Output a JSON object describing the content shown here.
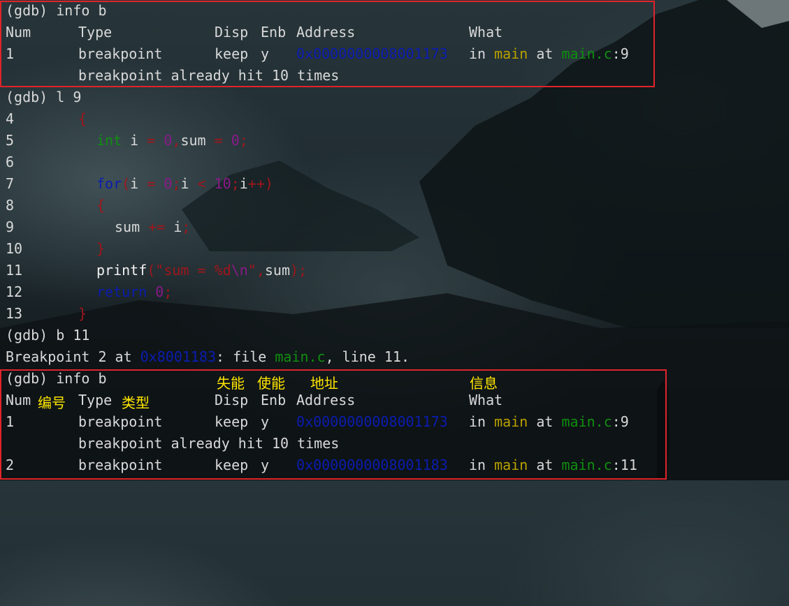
{
  "section1": {
    "prompt": "(gdb) info b",
    "header": {
      "num": "Num",
      "type": "Type",
      "disp": "Disp",
      "enb": "Enb",
      "address": "Address",
      "what": "What"
    },
    "row1": {
      "num": "1",
      "type": "breakpoint",
      "disp": "keep",
      "enb": "y",
      "address": "0x0000000008001173",
      "in": "in",
      "func": "main",
      "at": "at",
      "file": "main.c",
      "sep": ":",
      "line": "9"
    },
    "hit": "breakpoint already hit 10 times"
  },
  "list_cmd": "(gdb) l 9",
  "source": [
    {
      "n": "4"
    },
    {
      "n": "5",
      "kw": "int",
      "v1": " i ",
      "op1": "=",
      "sp1": " ",
      "num1": "0",
      "comma": ",",
      "v2": "sum ",
      "op2": "=",
      "sp2": " ",
      "num2": "0",
      "semi": ";"
    },
    {
      "n": "6"
    },
    {
      "n": "7",
      "kw": "for",
      "lp": "(",
      "v1": "i ",
      "op1": "=",
      "sp1": " ",
      "num1": "0",
      "semi1": ";",
      "v2": "i ",
      "op2": "<",
      "sp2": " ",
      "num2": "10",
      "semi2": ";",
      "v3": "i",
      "op3": "++",
      "rp": ")"
    },
    {
      "n": "8"
    },
    {
      "n": "9",
      "v1": "sum ",
      "op1": "+=",
      "v2": " i",
      "semi": ";"
    },
    {
      "n": "10"
    },
    {
      "n": "11",
      "fn": "printf",
      "lp": "(",
      "q1": "\"",
      "str": "sum = ",
      "fmt": "%d",
      "esc": "\\n",
      "q2": "\"",
      "comma": ",",
      "arg": "sum",
      "rp": ")",
      "semi": ";"
    },
    {
      "n": "12",
      "kw": "return",
      "sp": " ",
      "num": "0",
      "semi": ";"
    },
    {
      "n": "13"
    }
  ],
  "brace_open": "{",
  "brace_close": "}",
  "b_cmd": "(gdb) b 11",
  "bp_msg": {
    "pre": "Breakpoint 2 at ",
    "addr": "0x8001183",
    "mid": ": file ",
    "file": "main.c",
    "post": ", line 11."
  },
  "section2": {
    "prompt": "(gdb) info b",
    "header": {
      "num": "Num",
      "type": "Type",
      "disp": "Disp",
      "enb": "Enb",
      "address": "Address",
      "what": "What"
    },
    "row1": {
      "num": "1",
      "type": "breakpoint",
      "disp": "keep",
      "enb": "y",
      "address": "0x0000000008001173",
      "in": "in",
      "func": "main",
      "at": "at",
      "file": "main.c",
      "sep": ":",
      "line": "9"
    },
    "hit": "breakpoint already hit 10 times",
    "row2": {
      "num": "2",
      "type": "breakpoint",
      "disp": "keep",
      "enb": "y",
      "address": "0x0000000008001183",
      "in": "in",
      "func": "main",
      "at": "at",
      "file": "main.c",
      "sep": ":",
      "line": "11"
    }
  },
  "annotations": {
    "disp": "失能",
    "enb": "使能",
    "address": "地址",
    "what": "信息",
    "num": "编号",
    "type": "类型"
  },
  "colors": {
    "highlight_box": "#e0242a",
    "annotation": "#ffe600",
    "keyword": "#0f8f0f",
    "number": "#8a1a8a",
    "brace": "#a0161c",
    "address": "#0b1cb0",
    "func": "#b8a100"
  }
}
